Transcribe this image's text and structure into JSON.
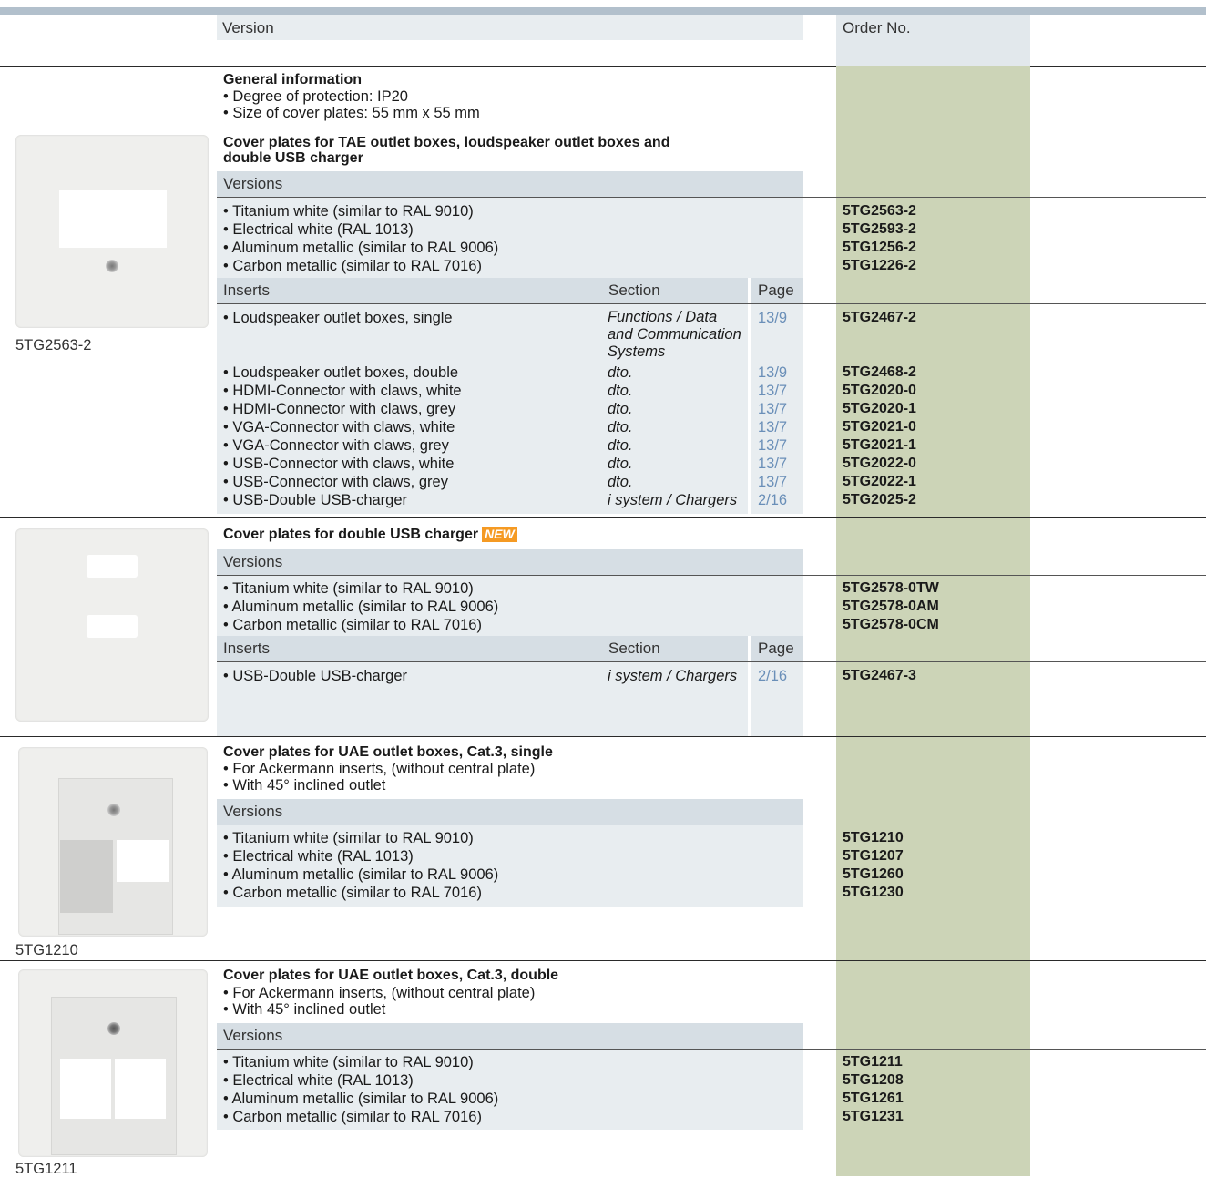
{
  "header": {
    "version_label": "Version",
    "order_label": "Order No."
  },
  "general": {
    "title": "General information",
    "items": [
      "• Degree of protection: IP20",
      "• Size of cover plates: 55 mm x 55 mm"
    ]
  },
  "tae": {
    "title_line1": "Cover plates for TAE outlet boxes, loudspeaker outlet boxes and",
    "title_line2": "double USB charger",
    "versions_label": "Versions",
    "versions": [
      {
        "text": "• Titanium white (similar to RAL 9010)",
        "order": "5TG2563-2"
      },
      {
        "text": "• Electrical white (RAL 1013)",
        "order": "5TG2593-2"
      },
      {
        "text": "• Aluminum metallic (similar to RAL 9006)",
        "order": "5TG1256-2"
      },
      {
        "text": "• Carbon metallic (similar to RAL 7016)",
        "order": "5TG1226-2"
      }
    ],
    "inserts_label": "Inserts",
    "section_label": "Section",
    "page_label": "Page",
    "first_insert": {
      "text": "• Loudspeaker outlet boxes, single",
      "section_lines": [
        "Functions / Data",
        "and Communication",
        "Systems"
      ],
      "page": "13/9",
      "order": "5TG2467-2"
    },
    "inserts": [
      {
        "text": "• Loudspeaker outlet boxes, double",
        "section": "dto.",
        "page": "13/9",
        "order": "5TG2468-2"
      },
      {
        "text": "• HDMI-Connector with claws, white",
        "section": "dto.",
        "page": "13/7",
        "order": "5TG2020-0"
      },
      {
        "text": "• HDMI-Connector with claws, grey",
        "section": "dto.",
        "page": "13/7",
        "order": "5TG2020-1"
      },
      {
        "text": "• VGA-Connector with claws, white",
        "section": "dto.",
        "page": "13/7",
        "order": "5TG2021-0"
      },
      {
        "text": "• VGA-Connector with claws, grey",
        "section": "dto.",
        "page": "13/7",
        "order": "5TG2021-1"
      },
      {
        "text": "• USB-Connector with claws, white",
        "section": "dto.",
        "page": "13/7",
        "order": "5TG2022-0"
      },
      {
        "text": "• USB-Connector with claws, grey",
        "section": "dto.",
        "page": "13/7",
        "order": "5TG2022-1"
      },
      {
        "text": "• USB-Double USB-charger",
        "section": "i system / Chargers",
        "page": "2/16",
        "order": "5TG2025-2"
      }
    ],
    "caption": "5TG2563-2"
  },
  "usb": {
    "title": "Cover plates for double USB charger",
    "badge": "NEW",
    "versions_label": "Versions",
    "versions": [
      {
        "text": "• Titanium white (similar to RAL 9010)",
        "order": "5TG2578-0TW"
      },
      {
        "text": "• Aluminum metallic (similar to RAL 9006)",
        "order": "5TG2578-0AM"
      },
      {
        "text": "• Carbon metallic (similar to RAL 7016)",
        "order": "5TG2578-0CM"
      }
    ],
    "inserts_label": "Inserts",
    "section_label": "Section",
    "page_label": "Page",
    "insert": {
      "text": "• USB-Double USB-charger",
      "section": "i system / Chargers",
      "page": "2/16",
      "order": "5TG2467-3"
    }
  },
  "uae_single": {
    "title": "Cover plates for UAE outlet boxes, Cat.3, single",
    "notes": [
      "• For Ackermann inserts, (without central plate)",
      "• With 45° inclined outlet"
    ],
    "versions_label": "Versions",
    "versions": [
      {
        "text": "• Titanium white (similar to RAL 9010)",
        "order": "5TG1210"
      },
      {
        "text": "• Electrical white (RAL 1013)",
        "order": "5TG1207"
      },
      {
        "text": "• Aluminum metallic (similar to RAL 9006)",
        "order": "5TG1260"
      },
      {
        "text": "• Carbon metallic (similar to RAL 7016)",
        "order": "5TG1230"
      }
    ],
    "caption": "5TG1210"
  },
  "uae_double": {
    "title": "Cover plates for UAE outlet boxes, Cat.3, double",
    "notes": [
      "• For Ackermann inserts, (without central plate)",
      "• With 45° inclined outlet"
    ],
    "versions_label": "Versions",
    "versions": [
      {
        "text": "• Titanium white (similar to RAL 9010)",
        "order": "5TG1211"
      },
      {
        "text": "• Electrical white (RAL 1013)",
        "order": "5TG1208"
      },
      {
        "text": "• Aluminum metallic (similar to RAL 9006)",
        "order": "5TG1261"
      },
      {
        "text": "• Carbon metallic (similar to RAL 7016)",
        "order": "5TG1231"
      }
    ],
    "caption": "5TG1211"
  }
}
